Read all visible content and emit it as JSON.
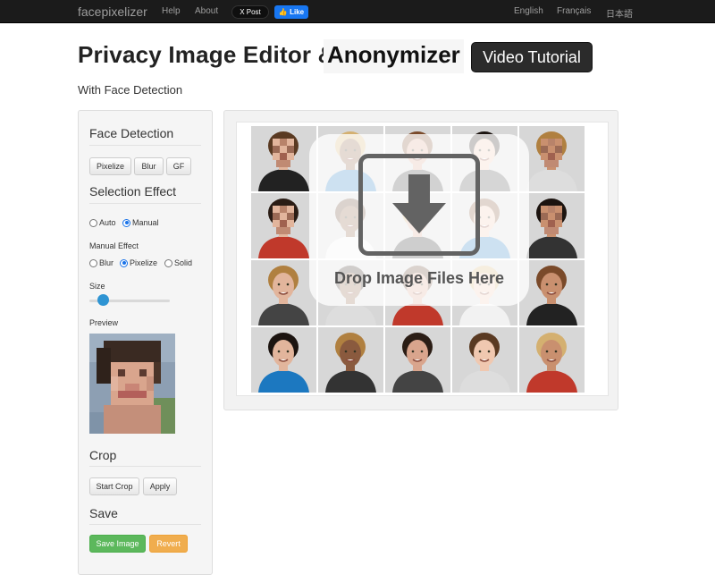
{
  "navbar": {
    "brand": "facepixelizer",
    "links": [
      "Help",
      "About"
    ],
    "x_post": "X Post",
    "fb_like": "Like",
    "languages": [
      "English",
      "Français",
      "日本語"
    ]
  },
  "header": {
    "title": "Privacy Image Editor &",
    "title_highlight": "Anonymizer",
    "tutorial_button": "Video Tutorial",
    "subtitle": "With Face Detection"
  },
  "sidebar": {
    "face_detection": {
      "title": "Face Detection",
      "buttons": [
        "Pixelize",
        "Blur",
        "GF"
      ]
    },
    "selection_effect": {
      "title": "Selection Effect",
      "modes": [
        {
          "label": "Auto",
          "selected": false
        },
        {
          "label": "Manual",
          "selected": true
        }
      ],
      "manual_effect_label": "Manual Effect",
      "effects": [
        {
          "label": "Blur",
          "selected": false
        },
        {
          "label": "Pixelize",
          "selected": true
        },
        {
          "label": "Solid",
          "selected": false
        }
      ],
      "size_label": "Size",
      "size_value_fraction": 0.2,
      "preview_label": "Preview"
    },
    "crop": {
      "title": "Crop",
      "buttons": [
        "Start Crop",
        "Apply"
      ]
    },
    "save": {
      "title": "Save",
      "save_button": "Save Image",
      "revert_button": "Revert"
    }
  },
  "canvas": {
    "drop_text": "Drop Image Files Here",
    "drop_icon": "download-arrow-icon",
    "photo_grid": {
      "rows": 4,
      "cols": 5
    }
  },
  "colors": {
    "navbar": "#1b1b1b",
    "save_green": "#5cb85c",
    "revert_orange": "#f0ad4e",
    "slider_blue": "#2e94d3"
  }
}
